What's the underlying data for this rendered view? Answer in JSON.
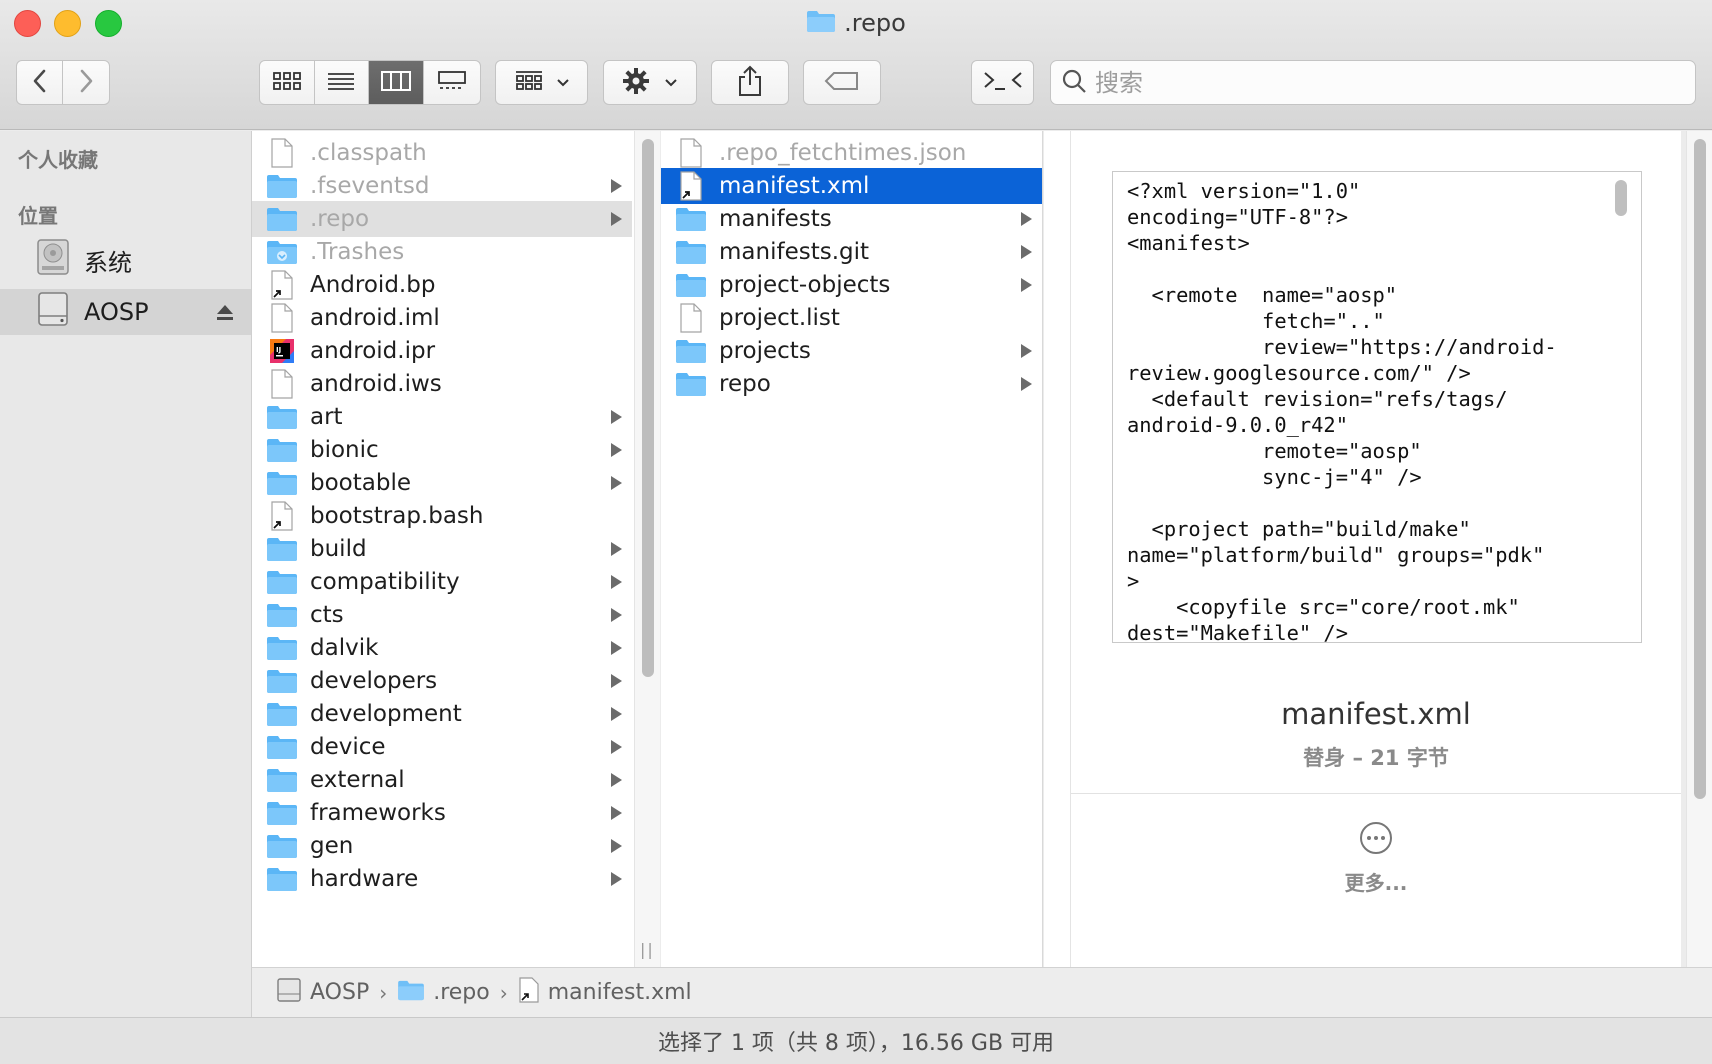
{
  "window": {
    "title": ".repo"
  },
  "toolbar": {
    "back_icon": "chevron-left-icon",
    "forward_icon": "chevron-right-icon",
    "view_modes": [
      "icon-view",
      "list-view",
      "column-view",
      "gallery-view"
    ],
    "active_view": "column-view",
    "search_placeholder": "搜索"
  },
  "sidebar": {
    "favorites_header": "个人收藏",
    "locations_header": "位置",
    "items": [
      {
        "label": "系统",
        "icon": "hard-disk-icon"
      },
      {
        "label": "AOSP",
        "icon": "external-drive-icon",
        "selected": true
      }
    ]
  },
  "column1": {
    "items": [
      {
        "name": ".classpath",
        "type": "file",
        "dim": true
      },
      {
        "name": ".fseventsd",
        "type": "folder",
        "dim": true,
        "arrow": true
      },
      {
        "name": ".repo",
        "type": "folder",
        "dim": true,
        "arrow": true,
        "highlight": true
      },
      {
        "name": ".Trashes",
        "type": "folder-trash",
        "dim": true
      },
      {
        "name": "Android.bp",
        "type": "alias"
      },
      {
        "name": "android.iml",
        "type": "file"
      },
      {
        "name": "android.ipr",
        "type": "app-ij"
      },
      {
        "name": "android.iws",
        "type": "file"
      },
      {
        "name": "art",
        "type": "folder",
        "arrow": true
      },
      {
        "name": "bionic",
        "type": "folder",
        "arrow": true
      },
      {
        "name": "bootable",
        "type": "folder",
        "arrow": true
      },
      {
        "name": "bootstrap.bash",
        "type": "alias"
      },
      {
        "name": "build",
        "type": "folder",
        "arrow": true
      },
      {
        "name": "compatibility",
        "type": "folder",
        "arrow": true
      },
      {
        "name": "cts",
        "type": "folder",
        "arrow": true
      },
      {
        "name": "dalvik",
        "type": "folder",
        "arrow": true
      },
      {
        "name": "developers",
        "type": "folder",
        "arrow": true
      },
      {
        "name": "development",
        "type": "folder",
        "arrow": true
      },
      {
        "name": "device",
        "type": "folder",
        "arrow": true
      },
      {
        "name": "external",
        "type": "folder",
        "arrow": true
      },
      {
        "name": "frameworks",
        "type": "folder",
        "arrow": true
      },
      {
        "name": "gen",
        "type": "folder",
        "arrow": true
      },
      {
        "name": "hardware",
        "type": "folder",
        "arrow": true
      }
    ]
  },
  "column2": {
    "items": [
      {
        "name": ".repo_fetchtimes.json",
        "type": "file",
        "dim": true
      },
      {
        "name": "manifest.xml",
        "type": "alias",
        "selected": true
      },
      {
        "name": "manifests",
        "type": "folder",
        "arrow": true
      },
      {
        "name": "manifests.git",
        "type": "folder",
        "arrow": true
      },
      {
        "name": "project-objects",
        "type": "folder",
        "arrow": true
      },
      {
        "name": "project.list",
        "type": "file"
      },
      {
        "name": "projects",
        "type": "folder",
        "arrow": true
      },
      {
        "name": "repo",
        "type": "folder",
        "arrow": true
      }
    ]
  },
  "preview": {
    "code": "<?xml version=\"1.0\"\nencoding=\"UTF-8\"?>\n<manifest>\n\n  <remote  name=\"aosp\"\n           fetch=\"..\"\n           review=\"https://android-\nreview.googlesource.com/\" />\n  <default revision=\"refs/tags/\nandroid-9.0.0_r42\"\n           remote=\"aosp\"\n           sync-j=\"4\" />\n\n  <project path=\"build/make\"\nname=\"platform/build\" groups=\"pdk\"\n>\n    <copyfile src=\"core/root.mk\"\ndest=\"Makefile\" />",
    "file_name": "manifest.xml",
    "meta": "替身 – 21 字节",
    "more_label": "更多..."
  },
  "pathbar": {
    "crumbs": [
      "AOSP",
      ".repo",
      "manifest.xml"
    ]
  },
  "status": {
    "text": "选择了 1 项（共 8 项），16.56 GB 可用"
  },
  "colors": {
    "selection": "#0b63d7",
    "folder": "#5bb6f6",
    "traffic_close": "#fd5f57",
    "traffic_min": "#febc2e",
    "traffic_max": "#28c840"
  }
}
